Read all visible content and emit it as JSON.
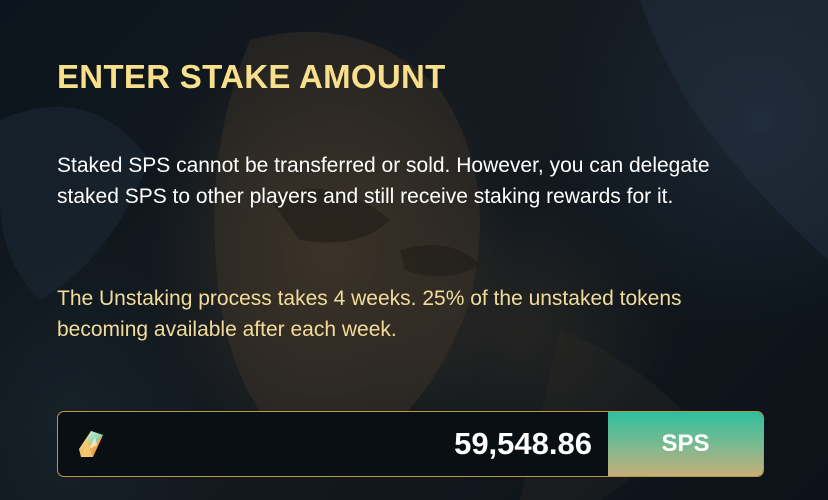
{
  "dialog": {
    "title": "ENTER STAKE AMOUNT",
    "description": "Staked SPS cannot be transferred or sold. However, you can delegate staked SPS to other players and still receive staking rewards for it.",
    "unstake_notice": "The Unstaking process takes 4 weeks. 25% of the unstaked tokens becoming available after each week."
  },
  "stake_input": {
    "value": "59,548.86",
    "token_icon": "sps-crystal-icon",
    "unit_label": "SPS"
  },
  "colors": {
    "title": "#f7df8b",
    "notice": "#f2dc9a",
    "field_border": "#b8964a",
    "unit_gradient_top": "#2fc09e",
    "unit_gradient_bottom": "#c8ae78"
  }
}
